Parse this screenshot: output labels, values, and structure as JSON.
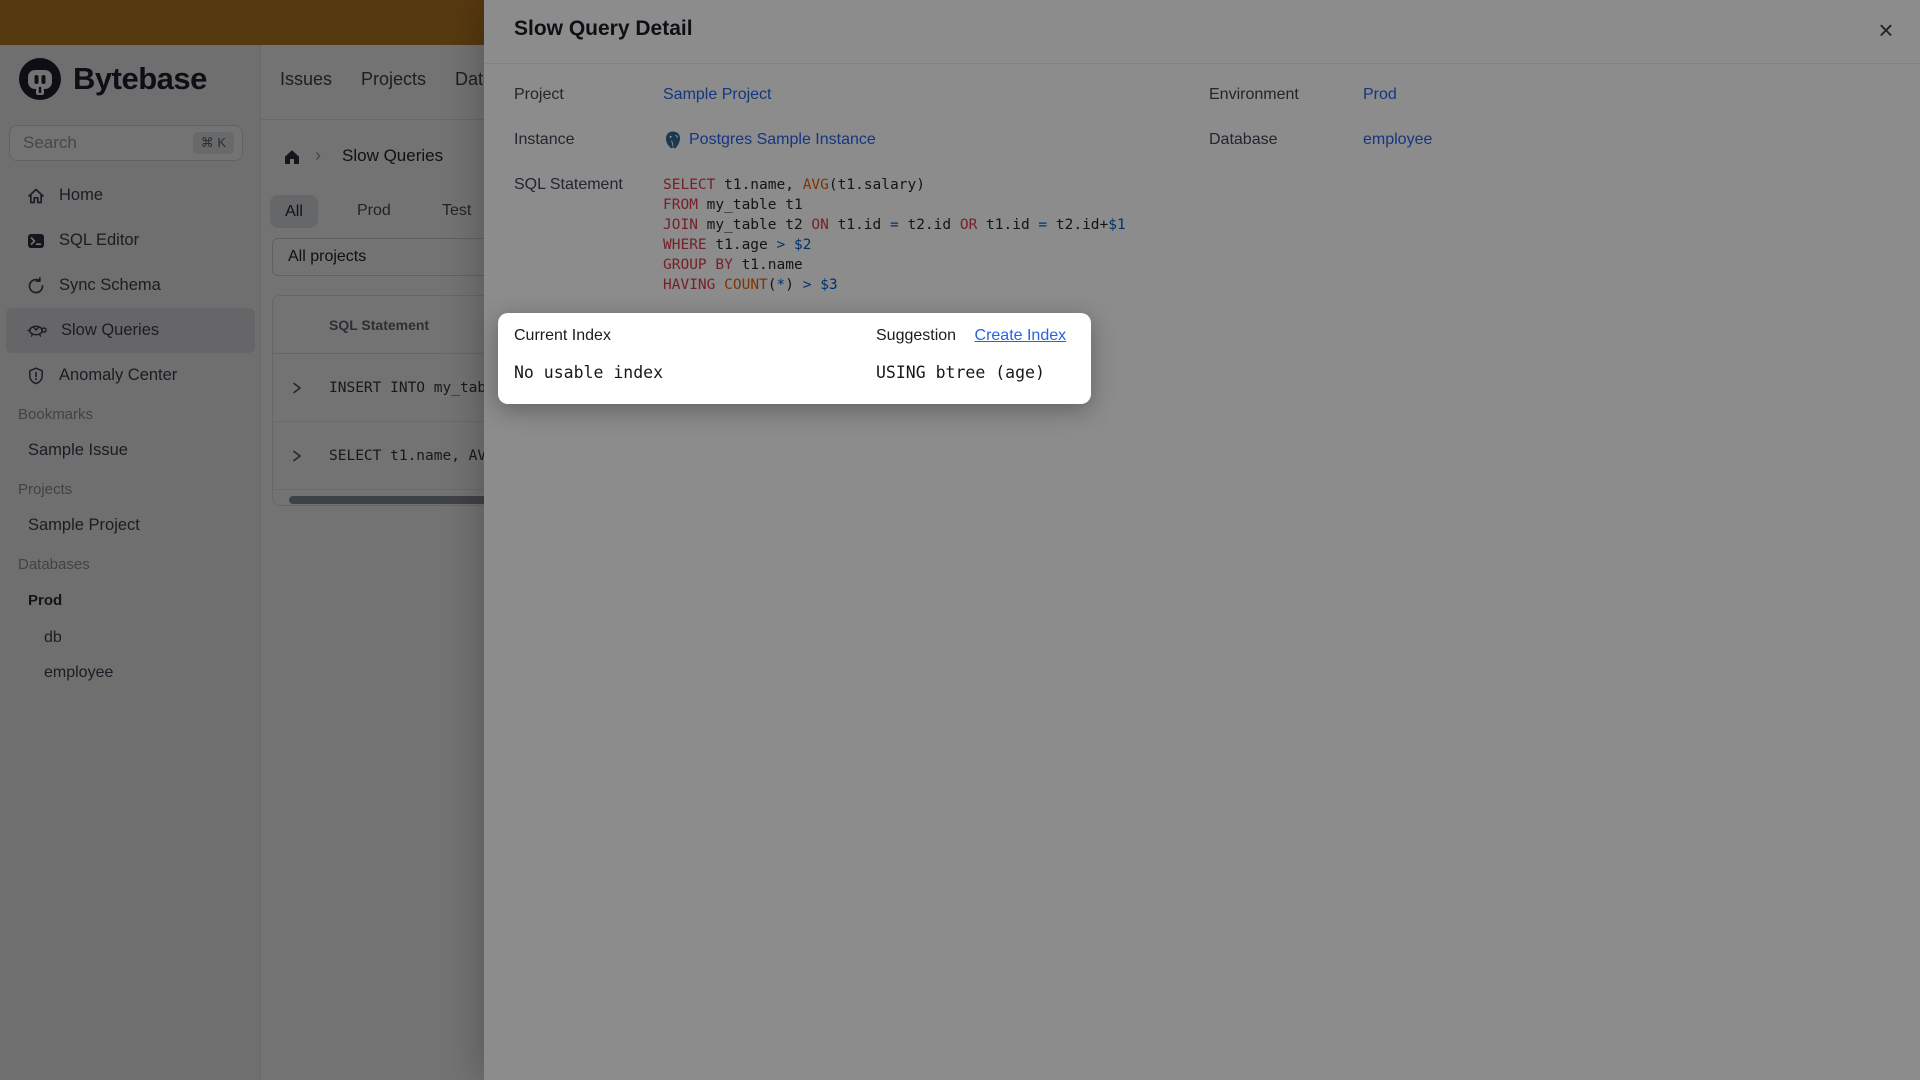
{
  "colors": {
    "banner": "#c28126",
    "link_blue": "#2563eb",
    "sql_keyword": "#d73a49",
    "sql_builtin": "#e36209",
    "sql_operator": "#005cc5"
  },
  "sidebar": {
    "logo_text": "Bytebase",
    "search": {
      "placeholder": "Search",
      "shortcut": "⌘ K"
    },
    "nav": [
      {
        "label": "Home",
        "icon": "home-icon"
      },
      {
        "label": "SQL Editor",
        "icon": "terminal-icon"
      },
      {
        "label": "Sync Schema",
        "icon": "sync-icon"
      },
      {
        "label": "Slow Queries",
        "icon": "turtle-icon"
      },
      {
        "label": "Anomaly Center",
        "icon": "shield-icon"
      }
    ],
    "sections": [
      {
        "title": "Bookmarks",
        "items": [
          "Sample Issue"
        ]
      },
      {
        "title": "Projects",
        "items": [
          "Sample Project"
        ]
      },
      {
        "title": "Databases",
        "env": "Prod",
        "databases": [
          "db",
          "employee"
        ]
      }
    ]
  },
  "main": {
    "top_nav": [
      "Issues",
      "Projects",
      "Databases"
    ],
    "breadcrumb": {
      "current": "Slow Queries"
    },
    "tabs": [
      "All",
      "Prod",
      "Test"
    ],
    "active_tab": "All",
    "project_filter": "All projects",
    "table": {
      "header": "SQL Statement",
      "rows": [
        "INSERT INTO my_tab",
        "SELECT t1.name, AV"
      ]
    }
  },
  "modal": {
    "title": "Slow Query Detail",
    "close": "×",
    "project": {
      "label": "Project",
      "value": "Sample Project"
    },
    "environment": {
      "label": "Environment",
      "value": "Prod"
    },
    "instance": {
      "label": "Instance",
      "value": "Postgres Sample Instance"
    },
    "database": {
      "label": "Database",
      "value": "employee"
    },
    "sql": {
      "label": "SQL Statement",
      "lines": [
        [
          {
            "t": "kw",
            "v": "SELECT"
          },
          {
            "t": "pl",
            "v": " t1.name, "
          },
          {
            "t": "fn",
            "v": "AVG"
          },
          {
            "t": "pl",
            "v": "(t1.salary)"
          }
        ],
        [
          {
            "t": "kw",
            "v": "FROM"
          },
          {
            "t": "pl",
            "v": " my_table t1"
          }
        ],
        [
          {
            "t": "kw",
            "v": "JOIN"
          },
          {
            "t": "pl",
            "v": " my_table t2 "
          },
          {
            "t": "kw",
            "v": "ON"
          },
          {
            "t": "pl",
            "v": " t1.id "
          },
          {
            "t": "op",
            "v": "="
          },
          {
            "t": "pl",
            "v": " t2.id "
          },
          {
            "t": "kw",
            "v": "OR"
          },
          {
            "t": "pl",
            "v": " t1.id "
          },
          {
            "t": "op",
            "v": "="
          },
          {
            "t": "pl",
            "v": " t2.id+"
          },
          {
            "t": "op",
            "v": "$1"
          }
        ],
        [
          {
            "t": "kw",
            "v": "WHERE"
          },
          {
            "t": "pl",
            "v": " t1.age "
          },
          {
            "t": "op",
            "v": ">"
          },
          {
            "t": "pl",
            "v": " "
          },
          {
            "t": "op",
            "v": "$2"
          }
        ],
        [
          {
            "t": "kw",
            "v": "GROUP BY"
          },
          {
            "t": "pl",
            "v": " t1.name"
          }
        ],
        [
          {
            "t": "kw",
            "v": "HAVING"
          },
          {
            "t": "pl",
            "v": " "
          },
          {
            "t": "fn",
            "v": "COUNT"
          },
          {
            "t": "pl",
            "v": "("
          },
          {
            "t": "op",
            "v": "*"
          },
          {
            "t": "pl",
            "v": ") "
          },
          {
            "t": "op",
            "v": ">"
          },
          {
            "t": "pl",
            "v": " "
          },
          {
            "t": "op",
            "v": "$3"
          }
        ]
      ]
    }
  },
  "popover": {
    "current": {
      "label": "Current Index",
      "value": "No usable index"
    },
    "suggestion": {
      "label": "Suggestion",
      "link": "Create Index",
      "value": "USING btree (age)"
    }
  }
}
